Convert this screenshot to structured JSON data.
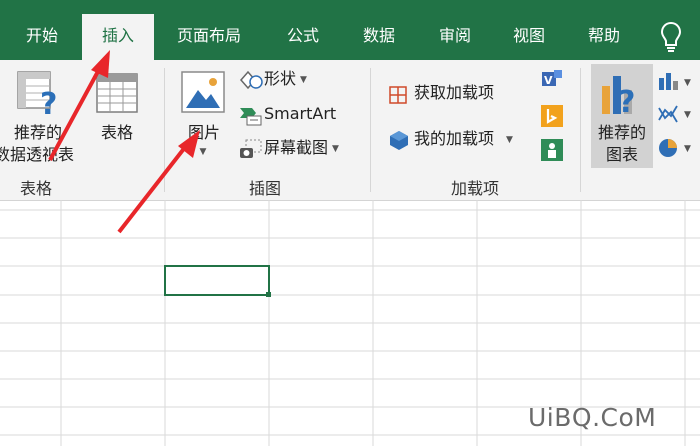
{
  "tabs": [
    {
      "label": "开始",
      "active": false
    },
    {
      "label": "插入",
      "active": true
    },
    {
      "label": "页面布局",
      "active": false
    },
    {
      "label": "公式",
      "active": false
    },
    {
      "label": "数据",
      "active": false
    },
    {
      "label": "审阅",
      "active": false
    },
    {
      "label": "视图",
      "active": false
    },
    {
      "label": "帮助",
      "active": false
    }
  ],
  "tell_me_icon": "lightbulb-icon",
  "ribbon": {
    "tables": {
      "recommended_pivot": {
        "line1": "推荐的",
        "line2": "数据透视表"
      },
      "table": "表格",
      "group": "表格"
    },
    "illustrations": {
      "pictures": "图片",
      "shapes": "形状",
      "smartart": "SmartArt",
      "screenshot": "屏幕截图",
      "group": "插图"
    },
    "addins": {
      "get_addins": "获取加载项",
      "my_addins": "我的加载项",
      "group": "加载项"
    },
    "charts": {
      "recommended": {
        "line1": "推荐的",
        "line2": "图表"
      }
    }
  },
  "watermark": "UiBQ.CoM",
  "colors": {
    "accent": "#217346",
    "arrow": "#e8262a",
    "ribbon": "#f3f3f3",
    "grid": "#dadada"
  }
}
